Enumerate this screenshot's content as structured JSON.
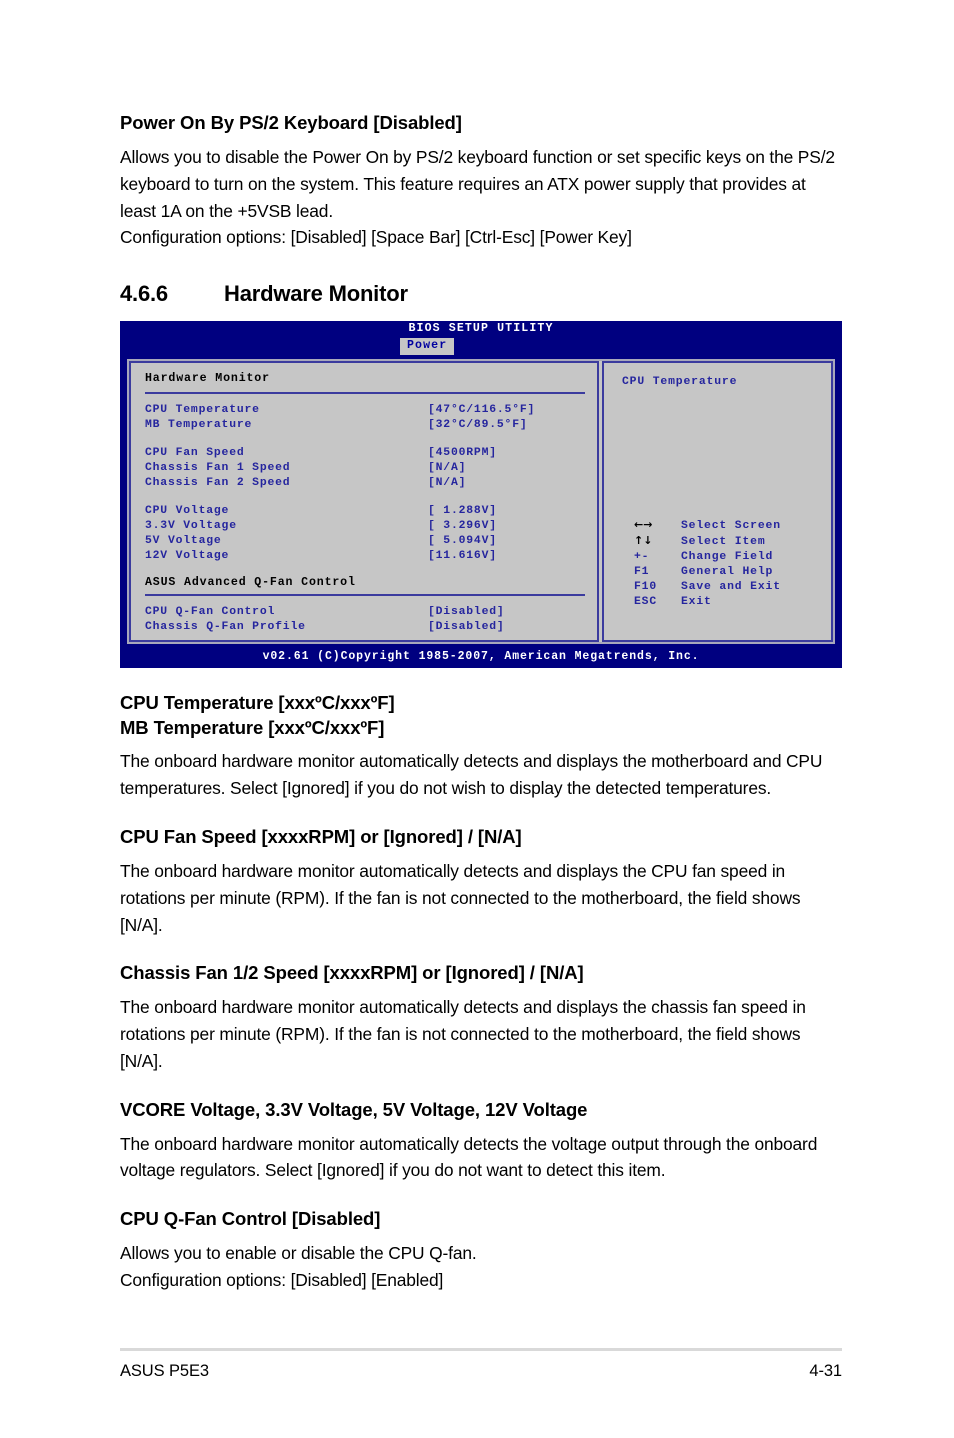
{
  "doc": {
    "footer_left": "ASUS P5E3",
    "footer_right": "4-31"
  },
  "top_section": {
    "heading": "Power On By PS/2 Keyboard [Disabled]",
    "paragraph": "Allows you to disable the Power On by PS/2 keyboard function or set specific keys on the PS/2 keyboard to turn on the system. This feature requires an ATX power supply that provides at least 1A on the +5VSB lead.",
    "config_options": "Configuration options: [Disabled] [Space Bar] [Ctrl-Esc] [Power Key]"
  },
  "section": {
    "number": "4.6.6",
    "title": "Hardware Monitor"
  },
  "bios": {
    "title": "BIOS SETUP UTILITY",
    "tab": "Power",
    "panel_title": "Hardware Monitor",
    "subhead": "ASUS Advanced Q-Fan Control",
    "items": [
      {
        "label": "CPU Temperature",
        "value": "[47°C/116.5°F]"
      },
      {
        "label": "MB Temperature",
        "value": "[32°C/89.5°F]"
      },
      {
        "label": "CPU Fan Speed",
        "value": "[4500RPM]"
      },
      {
        "label": "Chassis Fan 1 Speed",
        "value": "[N/A]"
      },
      {
        "label": "Chassis Fan 2 Speed",
        "value": "[N/A]"
      },
      {
        "label": "CPU Voltage",
        "value": "[ 1.288V]"
      },
      {
        "label": "3.3V  Voltage",
        "value": "[ 3.296V]"
      },
      {
        "label": "5V    Voltage",
        "value": "[ 5.094V]"
      },
      {
        "label": "12V   Voltage",
        "value": "[11.616V]"
      }
    ],
    "qfan_items": [
      {
        "label": "CPU Q-Fan Control",
        "value": "[Disabled]"
      },
      {
        "label": "Chassis Q-Fan Profile",
        "value": "[Disabled]"
      }
    ],
    "help_title": "CPU Temperature",
    "legend": [
      {
        "key": "←→",
        "desc": "Select Screen",
        "icon": "left-right-arrow-icon"
      },
      {
        "key": "↑↓",
        "desc": "Select Item",
        "icon": "up-down-arrow-icon"
      },
      {
        "key": "+-",
        "desc": "Change Field",
        "icon": "plus-minus-icon"
      },
      {
        "key": "F1",
        "desc": "General Help",
        "icon": "f1-key-icon"
      },
      {
        "key": "F10",
        "desc": "Save and Exit",
        "icon": "f10-key-icon"
      },
      {
        "key": "ESC",
        "desc": "Exit",
        "icon": "esc-key-icon"
      }
    ],
    "copyright": "v02.61 (C)Copyright 1985-2007, American Megatrends, Inc.",
    "colors": {
      "chrome_blue": "#000080",
      "panel_gray": "#c6c6c6",
      "text_blue": "#25259e",
      "border_blue": "#3b3b9e"
    }
  },
  "blocks": [
    {
      "heading_line1": "CPU Temperature [xxxºC/xxxºF]",
      "heading_line2": "MB Temperature [xxxºC/xxxºF]",
      "paragraph": "The onboard hardware monitor automatically detects and displays the motherboard and CPU temperatures. Select [Ignored] if you do not wish to display the detected temperatures."
    },
    {
      "heading_line1": "CPU Fan Speed [xxxxRPM] or [Ignored] / [N/A]",
      "paragraph": "The onboard hardware monitor automatically detects and displays the CPU fan speed in rotations per minute (RPM). If the fan is not connected to the motherboard, the field shows [N/A]."
    },
    {
      "heading_line1": "Chassis Fan 1/2 Speed [xxxxRPM] or [Ignored] / [N/A]",
      "paragraph": "The onboard hardware monitor automatically detects and displays the chassis fan speed in rotations per minute (RPM). If the fan is not connected to the motherboard, the field shows [N/A]."
    },
    {
      "heading_line1": "VCORE Voltage, 3.3V Voltage, 5V Voltage, 12V Voltage",
      "paragraph": "The onboard hardware monitor automatically detects the voltage output through the onboard voltage regulators. Select [Ignored] if you do not want to detect this item."
    },
    {
      "heading_line1": "CPU Q-Fan Control [Disabled]",
      "paragraph": "Allows you to enable or disable the CPU Q-fan.",
      "paragraph2": "Configuration options: [Disabled] [Enabled]"
    }
  ]
}
